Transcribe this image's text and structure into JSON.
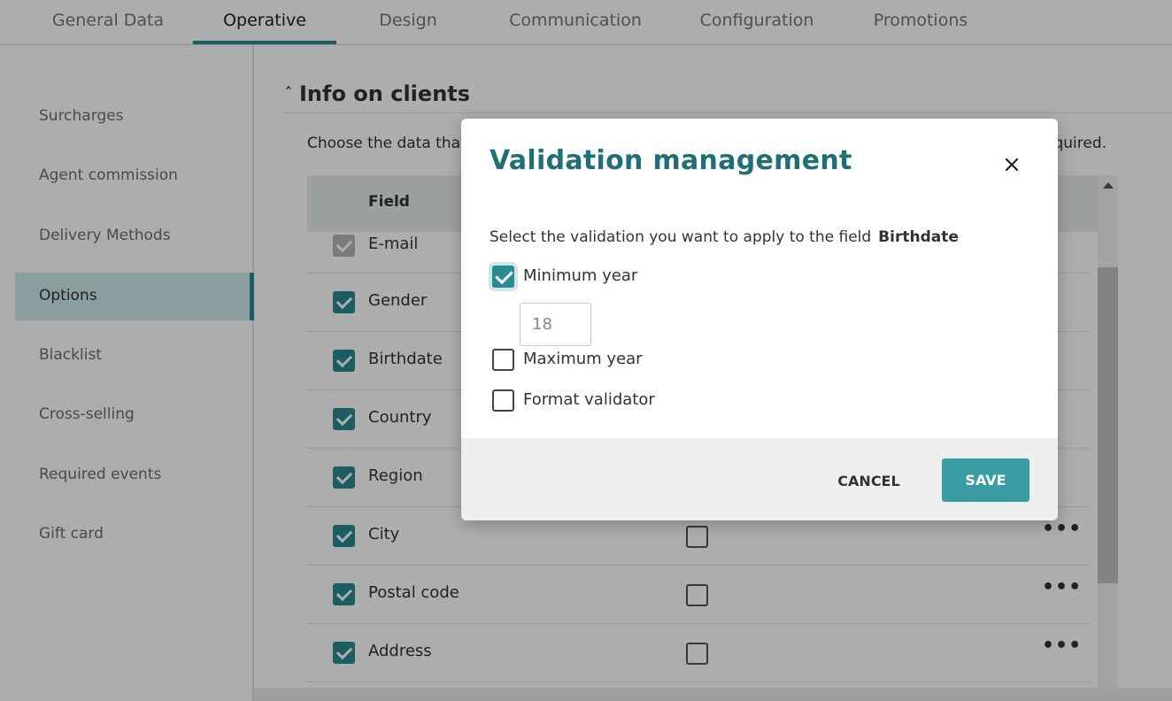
{
  "tabs": [
    {
      "label": "General Data"
    },
    {
      "label": "Operative"
    },
    {
      "label": "Design"
    },
    {
      "label": "Communication"
    },
    {
      "label": "Configuration"
    },
    {
      "label": "Promotions"
    }
  ],
  "active_tab": "Operative",
  "sidebar": {
    "items": [
      {
        "label": "Surcharges"
      },
      {
        "label": "Agent commission"
      },
      {
        "label": "Delivery Methods"
      },
      {
        "label": "Options"
      },
      {
        "label": "Blacklist"
      },
      {
        "label": "Cross-selling"
      },
      {
        "label": "Required events"
      },
      {
        "label": "Gift card"
      }
    ],
    "active": "Options"
  },
  "section": {
    "title": "Info on clients",
    "description_start": "Choose the data that",
    "description_end": "equired."
  },
  "table": {
    "header_field": "Field",
    "rows": [
      {
        "label": "E-mail",
        "checked": true,
        "disabled": true
      },
      {
        "label": "Gender",
        "checked": true
      },
      {
        "label": "Birthdate",
        "checked": true
      },
      {
        "label": "Country",
        "checked": true
      },
      {
        "label": "Region",
        "checked": true
      },
      {
        "label": "City",
        "checked": true,
        "required_checkbox": true
      },
      {
        "label": "Postal code",
        "checked": true,
        "required_checkbox": true
      },
      {
        "label": "Address",
        "checked": true,
        "required_checkbox": true
      }
    ],
    "more_label": "•••"
  },
  "modal": {
    "title": "Validation management",
    "intro": "Select the validation you want to apply to the field",
    "field_name": "Birthdate",
    "options": [
      {
        "label": "Minimum year",
        "checked": true
      },
      {
        "label": "Maximum year",
        "checked": false
      },
      {
        "label": "Format validator",
        "checked": false
      }
    ],
    "min_year_value": "18",
    "cancel_label": "CANCEL",
    "save_label": "SAVE"
  },
  "colors": {
    "accent": "#2a8a91",
    "title": "#1e6f76",
    "save_button": "#3a9ba2",
    "active_sidebar_bg": "#cde9ea"
  }
}
